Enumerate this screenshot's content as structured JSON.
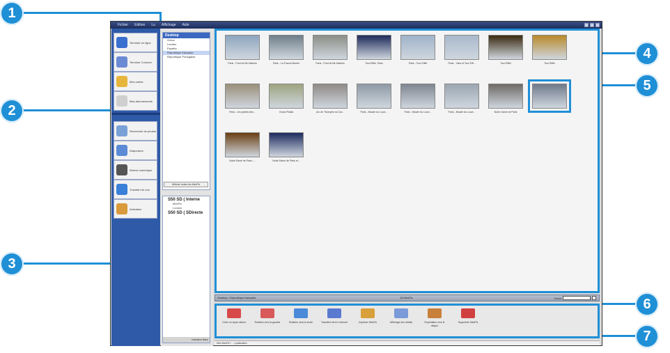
{
  "callouts": [
    "1",
    "2",
    "3",
    "4",
    "5",
    "6",
    "7"
  ],
  "menu": [
    "Fichier",
    "Edition",
    "Lu",
    "Affichage",
    "Aide"
  ],
  "task_panel": {
    "items": [
      {
        "label": "Terminer en ligne",
        "icon": "globe-icon",
        "color": "#3a6fd0"
      },
      {
        "label": "Terminer Connect",
        "icon": "magnifier-icon",
        "color": "#6b8ad4"
      },
      {
        "label": "Mes cartes",
        "icon": "cards-icon",
        "color": "#e6b53b"
      },
      {
        "label": "Mes abonnements",
        "icon": "document-icon",
        "color": "#cfcfcf"
      },
      {
        "label": "Recherche de photos",
        "icon": "photo-search-icon",
        "color": "#7aa0d8"
      },
      {
        "label": "Diaporama",
        "icon": "slideshow-icon",
        "color": "#5b8bd6"
      },
      {
        "label": "Relevé numérique",
        "icon": "film-icon",
        "color": "#555555"
      },
      {
        "label": "Transfert de vos",
        "icon": "transfer-icon",
        "color": "#3a7fd8"
      },
      {
        "label": "Activation",
        "icon": "person-icon",
        "color": "#d89a3a"
      }
    ]
  },
  "folder_tree": {
    "header": "Desktop",
    "rows": [
      "Grèce",
      "London",
      "España",
      "République française",
      "République Portugaise"
    ],
    "selected": 3,
    "button": "Afficher toutes les MesPix"
  },
  "cameras": {
    "camera1": "S50 SD ( Interne",
    "sub1": "MesPix",
    "sub2": "London",
    "camera2": "S50 SD ( SDirecte",
    "footer": "Indication   Base"
  },
  "photos": [
    {
      "caption": "Paris - Pont de Bir-Hakeim",
      "color": "#8ea6bf"
    },
    {
      "caption": "Paris - La France liberée",
      "color": "#6f7f8a"
    },
    {
      "caption": "Paris - Pont de Bir-Hakeim",
      "color": "#8c8f87"
    },
    {
      "caption": "Tour Eiffel, Paris",
      "color": "#1e2a5a"
    },
    {
      "caption": "Paris - Tour Eiffel",
      "color": "#9fb3c9"
    },
    {
      "caption": "Paris - View of Tour Eiff...",
      "color": "#a8b9cc"
    },
    {
      "caption": "Tour Eiffel",
      "color": "#3a2a10"
    },
    {
      "caption": "Tour Eiffel",
      "color": "#b98a2a"
    },
    {
      "caption": "Paris - Les jardins des...",
      "color": "#9a8f7a"
    },
    {
      "caption": "Grand Palais",
      "color": "#9da47f"
    },
    {
      "caption": "Arc de Triomphe du Car...",
      "color": "#8f8a86"
    },
    {
      "caption": "Paris - Musée du Louvr...",
      "color": "#8f9aa6"
    },
    {
      "caption": "Paris - Musée du Louvr...",
      "color": "#7f8691"
    },
    {
      "caption": "Paris - Musée du Louvr...",
      "color": "#9ba6b1"
    },
    {
      "caption": "Notre Dame de Paris",
      "color": "#6e6a66"
    },
    {
      "caption": "",
      "color": "#6f7a8a"
    },
    {
      "caption": "Notre Dame de Paris -...",
      "color": "#6a3e12"
    },
    {
      "caption": "Notre Dame de Paris et...",
      "color": "#1c2a5e"
    }
  ],
  "status_bar": {
    "path": "Desktop \\ République française",
    "count": "18 MesPix",
    "zoom_label": "Zoom"
  },
  "toolbar": [
    {
      "label": "Créer un super album",
      "icon": "album-add-icon",
      "color": "#d84a4a"
    },
    {
      "label": "Rotation vers la gauche",
      "icon": "rotate-left-icon",
      "color": "#d85a5a"
    },
    {
      "label": "Rotation vers la droite",
      "icon": "rotate-right-icon",
      "color": "#4a8ad8"
    },
    {
      "label": "Transfert vers le Internet",
      "icon": "transfer-internet-icon",
      "color": "#5a7ad0"
    },
    {
      "label": "Imprimer MesPix",
      "icon": "print-icon",
      "color": "#d8a03a"
    },
    {
      "label": "Affichage des détails",
      "icon": "details-icon",
      "color": "#7a9ad8"
    },
    {
      "label": "Exportation vers le disque",
      "icon": "export-icon",
      "color": "#c8803a"
    },
    {
      "label": "Supprimer MesPix",
      "icon": "delete-icon",
      "color": "#d04040"
    }
  ],
  "path_bar": "Mes MesPix \\ ...\\ publication"
}
